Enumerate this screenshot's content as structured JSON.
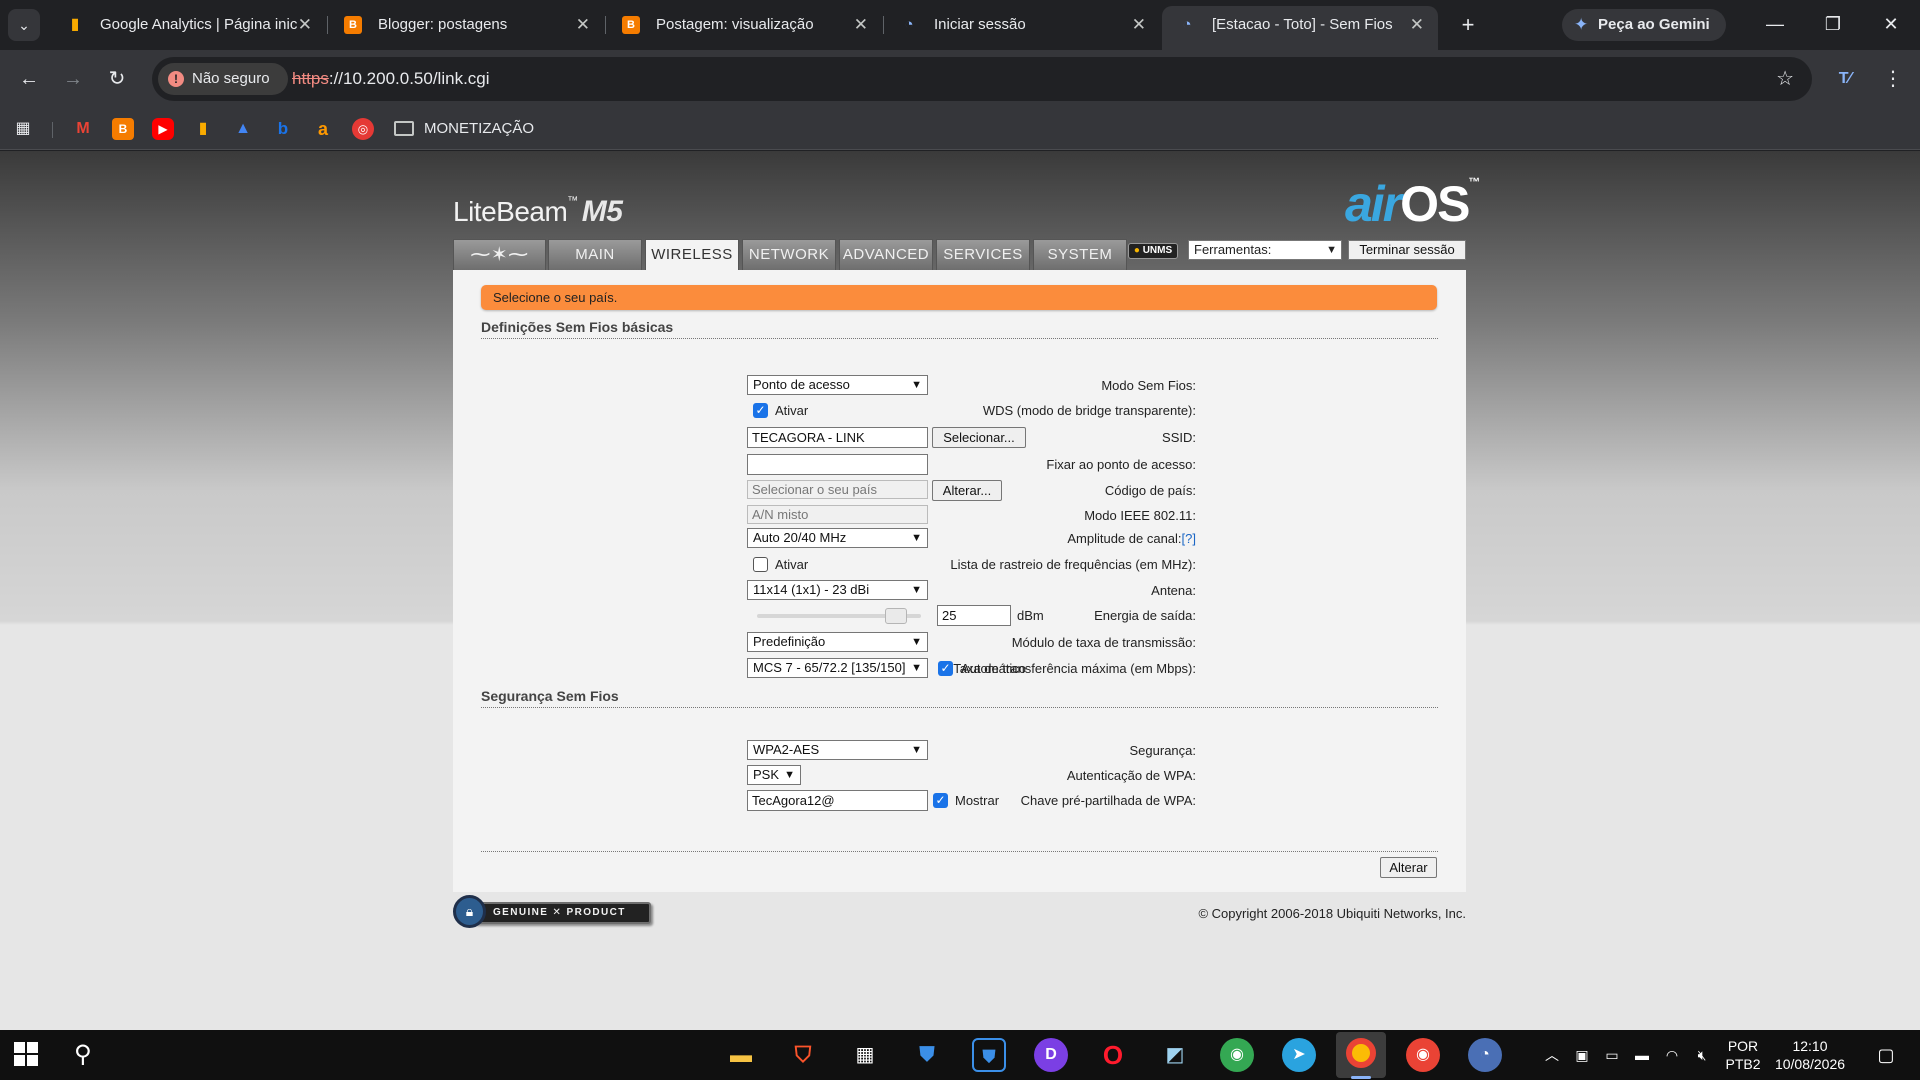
{
  "browser": {
    "tabs": [
      {
        "title": "Google Analytics | Página inic",
        "icon": "analytics-icon",
        "color": "#f9ab00"
      },
      {
        "title": "Blogger: postagens",
        "icon": "blogger-icon",
        "color": "#f57c00"
      },
      {
        "title": "Postagem: visualização",
        "icon": "blogger-icon",
        "color": "#f57c00"
      },
      {
        "title": "Iniciar sessão",
        "icon": "ubiquiti-icon",
        "color": "#8ab4f8"
      },
      {
        "title": "[Estacao - Toto] - Sem Fios",
        "icon": "ubiquiti-icon",
        "color": "#8ab4f8"
      }
    ],
    "gemini_label": "Peça ao Gemini",
    "security_chip": "Não seguro",
    "url_scheme": "https",
    "url_rest": "://10.200.0.50/link.cgi",
    "bookmark_folder": "MONETIZAÇÃO"
  },
  "airos": {
    "product_name": "LiteBeam",
    "product_model": "M5",
    "logo_air": "air",
    "logo_os": "OS",
    "tabs": [
      "MAIN",
      "WIRELESS",
      "NETWORK",
      "ADVANCED",
      "SERVICES",
      "SYSTEM"
    ],
    "active_tab": "WIRELESS",
    "unms_badge": "UNMS",
    "tools_select": "Ferramentas:",
    "logout_button": "Terminar sessão",
    "alert": "Selecione o seu país.",
    "section_basic": "Definições Sem Fios básicas",
    "section_security": "Segurança Sem Fios",
    "fields": {
      "wireless_mode": {
        "label": "Modo Sem Fios:",
        "value": "Ponto de acesso"
      },
      "wds": {
        "label": "WDS (modo de bridge transparente):",
        "checkbox_label": "Ativar",
        "checked": true
      },
      "ssid": {
        "label": "SSID:",
        "value": "TECAGORA - LINK",
        "button": "Selecionar..."
      },
      "lock_ap": {
        "label": "Fixar ao ponto de acesso:",
        "value": ""
      },
      "country": {
        "label": "Código de país:",
        "value": "Selecionar o seu país",
        "button": "Alterar..."
      },
      "ieee_mode": {
        "label": "Modo IEEE 802.11:",
        "value": "A/N misto"
      },
      "channel_width": {
        "label": "Amplitude de canal:",
        "help": "[?]",
        "value": "Auto 20/40 MHz"
      },
      "freq_scan": {
        "label": "Lista de rastreio de frequências (em MHz):",
        "checkbox_label": "Ativar",
        "checked": false
      },
      "antenna": {
        "label": "Antena:",
        "value": "11x14 (1x1) - 23 dBi"
      },
      "output_power": {
        "label": "Energia de saída:",
        "value": "25",
        "unit": "dBm",
        "slider_fraction": 0.9
      },
      "rate_module": {
        "label": "Módulo de taxa de transmissão:",
        "value": "Predefinição"
      },
      "max_rate": {
        "label": "Taxa de transferência máxima (em Mbps):",
        "value": "MCS 7 - 65/72.2 [135/150]",
        "checkbox_label": "Automático",
        "checked": true
      },
      "security": {
        "label": "Segurança:",
        "value": "WPA2-AES"
      },
      "wpa_auth": {
        "label": "Autenticação de WPA:",
        "value": "PSK"
      },
      "wpa_key": {
        "label": "Chave pré-partilhada de WPA:",
        "value": "TecAgora12@",
        "checkbox_label": "Mostrar",
        "checked": true
      }
    },
    "apply_button": "Alterar",
    "genuine_badge": "GENUINE ✕ PRODUCT",
    "copyright": "© Copyright 2006-2018 Ubiquiti Networks, Inc."
  },
  "taskbar": {
    "lang_top": "POR",
    "lang_bottom": "PTB2",
    "time": "12:10",
    "date": "10/08/2026"
  }
}
